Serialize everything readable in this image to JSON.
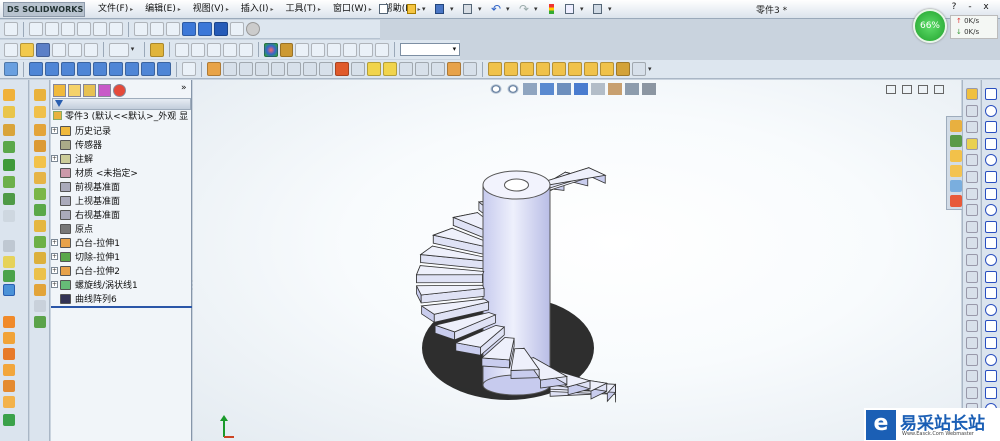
{
  "app": {
    "brand": "SOLIDWORKS",
    "brand_prefix": "DS",
    "doc_title": "零件3 *"
  },
  "menus": [
    "文件(F)",
    "编辑(E)",
    "视图(V)",
    "插入(I)",
    "工具(T)",
    "窗口(W)",
    "帮助(H)"
  ],
  "network": {
    "percent": "66%",
    "up": "0K/s",
    "down": "0K/s"
  },
  "tree": {
    "root": "零件3 (默认<<默认>_外观 显",
    "items": [
      {
        "label": "历史记录",
        "expand": true
      },
      {
        "label": "传感器",
        "expand": false
      },
      {
        "label": "注解",
        "expand": true
      },
      {
        "label": "材质 <未指定>",
        "expand": false
      },
      {
        "label": "前视基准面",
        "expand": false
      },
      {
        "label": "上视基准面",
        "expand": false
      },
      {
        "label": "右视基准面",
        "expand": false
      },
      {
        "label": "原点",
        "expand": false
      },
      {
        "label": "凸台-拉伸1",
        "expand": true
      },
      {
        "label": "切除-拉伸1",
        "expand": true
      },
      {
        "label": "凸台-拉伸2",
        "expand": true
      },
      {
        "label": "螺旋线/涡状线1",
        "expand": true
      },
      {
        "label": "曲线阵列6",
        "expand": false
      }
    ]
  },
  "window_buttons": [
    "?",
    "-",
    "x"
  ],
  "watermark": {
    "text": "易采站长站",
    "sub": "Www.Easck.Com Webmaster"
  },
  "colors": {
    "accent": "#2b56a8",
    "model": "#dfe2f5",
    "shadow": "#1c1c1c"
  }
}
